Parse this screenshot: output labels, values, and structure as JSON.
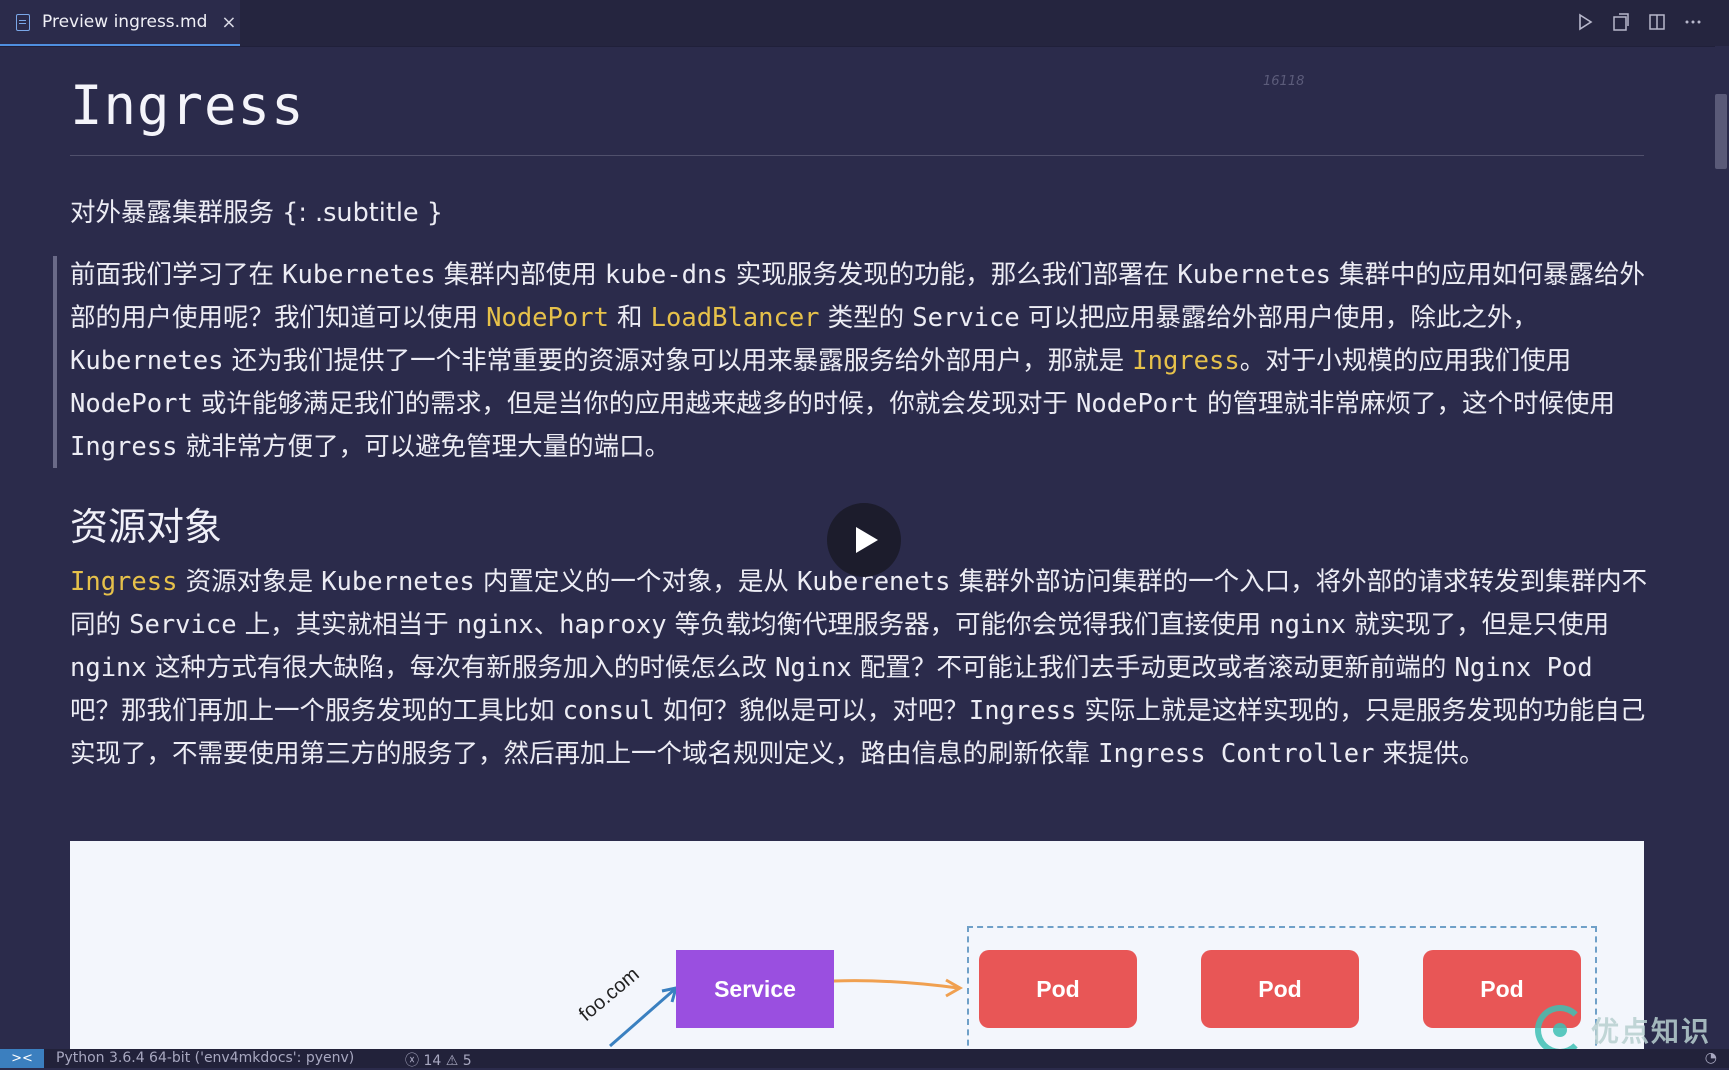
{
  "tab": {
    "title": "Preview ingress.md",
    "close": "×"
  },
  "toolbar": {
    "run_icon": "play-icon",
    "open_source_icon": "open-changes-icon",
    "split_icon": "split-editor-icon",
    "more_icon": "ellipsis-icon"
  },
  "doc": {
    "h1": "Ingress",
    "faint_text": "16118",
    "subtitle": "对外暴露集群服务 {: .subtitle }",
    "quote": [
      {
        "t": "前面我们学习了在 "
      },
      {
        "t": "Kubernetes",
        "k": "c"
      },
      {
        "t": " 集群内部使用 "
      },
      {
        "t": "kube-dns",
        "k": "c"
      },
      {
        "t": " 实现服务发现的功能，那么我们部署在 "
      },
      {
        "t": "Kubernetes",
        "k": "c"
      },
      {
        "t": " 集群中的应用如何暴露给外部的用户使用呢？我们知道可以使用 "
      },
      {
        "t": "NodePort",
        "k": "hl"
      },
      {
        "t": " 和 "
      },
      {
        "t": "LoadBlancer",
        "k": "hl"
      },
      {
        "t": " 类型的 "
      },
      {
        "t": "Service",
        "k": "c"
      },
      {
        "t": " 可以把应用暴露给外部用户使用，除此之外，"
      },
      {
        "t": "Kubernetes",
        "k": "c"
      },
      {
        "t": " 还为我们提供了一个非常重要的资源对象可以用来暴露服务给外部用户，那就是 "
      },
      {
        "t": "Ingress",
        "k": "hl"
      },
      {
        "t": "。对于小规模的应用我们使用 "
      },
      {
        "t": "NodePort",
        "k": "c"
      },
      {
        "t": " 或许能够满足我们的需求，但是当你的应用越来越多的时候，你就会发现对于 "
      },
      {
        "t": "NodePort",
        "k": "c"
      },
      {
        "t": " 的管理就非常麻烦了，这个时候使用 "
      },
      {
        "t": "Ingress",
        "k": "c"
      },
      {
        "t": " 就非常方便了，可以避免管理大量的端口。"
      }
    ],
    "h2": "资源对象",
    "para2": [
      {
        "t": "Ingress",
        "k": "hl"
      },
      {
        "t": " 资源对象是 "
      },
      {
        "t": "Kubernetes",
        "k": "c"
      },
      {
        "t": " 内置定义的一个对象，是从 "
      },
      {
        "t": "Kuberenets",
        "k": "c"
      },
      {
        "t": " 集群外部访问集群的一个入口，将外部的请求转发到集群内不同的 "
      },
      {
        "t": "Service",
        "k": "c"
      },
      {
        "t": " 上，其实就相当于 "
      },
      {
        "t": "nginx",
        "k": "c"
      },
      {
        "t": "、"
      },
      {
        "t": "haproxy",
        "k": "c"
      },
      {
        "t": " 等负载均衡代理服务器，可能你会觉得我们直接使用 "
      },
      {
        "t": "nginx",
        "k": "c"
      },
      {
        "t": " 就实现了，但是只使用 "
      },
      {
        "t": "nginx",
        "k": "c"
      },
      {
        "t": " 这种方式有很大缺陷，每次有新服务加入的时候怎么改 "
      },
      {
        "t": "Nginx",
        "k": "c"
      },
      {
        "t": " 配置？不可能让我们去手动更改或者滚动更新前端的 "
      },
      {
        "t": "Nginx Pod",
        "k": "c"
      },
      {
        "t": " 吧？那我们再加上一个服务发现的工具比如 "
      },
      {
        "t": "consul",
        "k": "c"
      },
      {
        "t": " 如何？貌似是可以，对吧？"
      },
      {
        "t": "Ingress",
        "k": "c"
      },
      {
        "t": " 实际上就是这样实现的，只是服务发现的功能自己实现了，不需要使用第三方的服务了，然后再加上一个域名规则定义，路由信息的刷新依靠 "
      },
      {
        "t": "Ingress Controller",
        "k": "c"
      },
      {
        "t": " 来提供。"
      }
    ]
  },
  "diagram": {
    "service_label": "Service",
    "pods": [
      "Pod",
      "Pod",
      "Pod"
    ],
    "host_label": "foo.com"
  },
  "video": {
    "play_icon": "play-button-icon"
  },
  "status": {
    "remote_icon": "remote-icon",
    "python": "Python 3.6.4 64-bit ('env4mkdocs': pyenv)",
    "errors": "14",
    "warnings": "5"
  },
  "watermark": {
    "text": "优点知识"
  },
  "colors": {
    "accent": "#e6c14a",
    "background": "#2b2b4b",
    "service": "#9a4fe0",
    "pod": "#e85656"
  }
}
